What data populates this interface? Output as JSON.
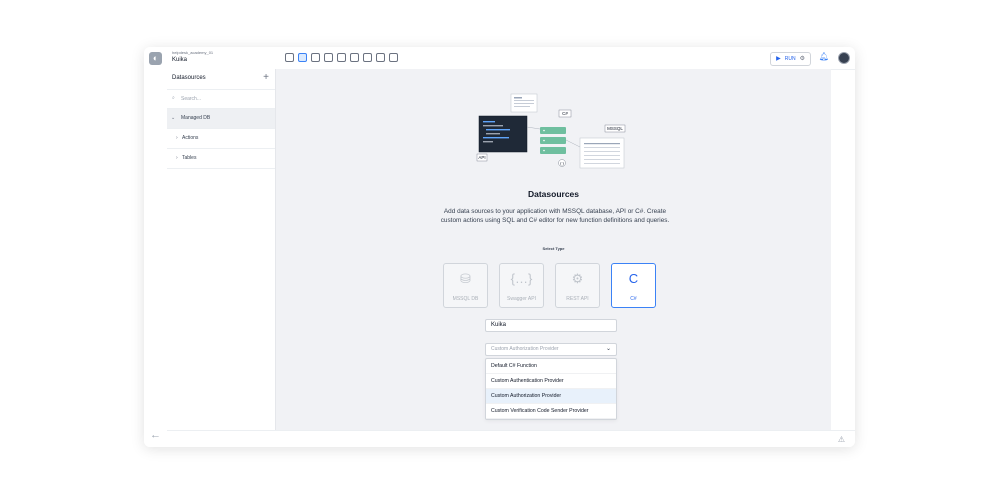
{
  "app": {
    "project_path": "helpdesk_academy_01",
    "project_name": "Kuika",
    "run_label": "RUN"
  },
  "toolbar": {
    "icons": [
      "components-icon",
      "datasources-icon",
      "workflow-icon",
      "search-icon",
      "table-icon",
      "theme-icon",
      "code-icon",
      "export-icon",
      "help-icon"
    ],
    "active_index": 1
  },
  "sidebar": {
    "title": "Datasources",
    "add_label": "+",
    "search_placeholder": "Search...",
    "items": [
      {
        "label": "Managed DB",
        "caret": "⌄",
        "selected": true
      },
      {
        "label": "Actions",
        "caret": "›"
      },
      {
        "label": "Tables",
        "caret": "›"
      }
    ]
  },
  "illustration": {
    "labels": [
      "C#",
      "MSSQL",
      "API",
      "{ }"
    ]
  },
  "main": {
    "title": "Datasources",
    "description": "Add data sources to your application with MSSQL database, API or C#. Create custom actions using SQL and C# editor for new function definitions and queries.",
    "select_type_label": "Select Type",
    "types": [
      {
        "label": "MSSQL DB",
        "icon": "database-icon",
        "glyph": "⛁",
        "active": false
      },
      {
        "label": "Swagger API",
        "icon": "swagger-icon",
        "glyph": "{…}",
        "active": false
      },
      {
        "label": "REST API",
        "icon": "api-gear-icon",
        "glyph": "⚙",
        "active": false
      },
      {
        "label": "C#",
        "icon": "csharp-icon",
        "glyph": "C",
        "active": true
      }
    ],
    "name_value": "Kuika",
    "provider_placeholder": "Custom Authorization Provider",
    "provider_options": [
      {
        "label": "Default C# Function",
        "highlighted": false
      },
      {
        "label": "Custom Authentication Provider",
        "highlighted": false
      },
      {
        "label": "Custom Authorization Provider",
        "highlighted": true
      },
      {
        "label": "Custom Verification Code Sender Provider",
        "highlighted": false
      }
    ]
  },
  "colors": {
    "accent": "#3b82f6",
    "canvas": "#f1f2f5"
  }
}
